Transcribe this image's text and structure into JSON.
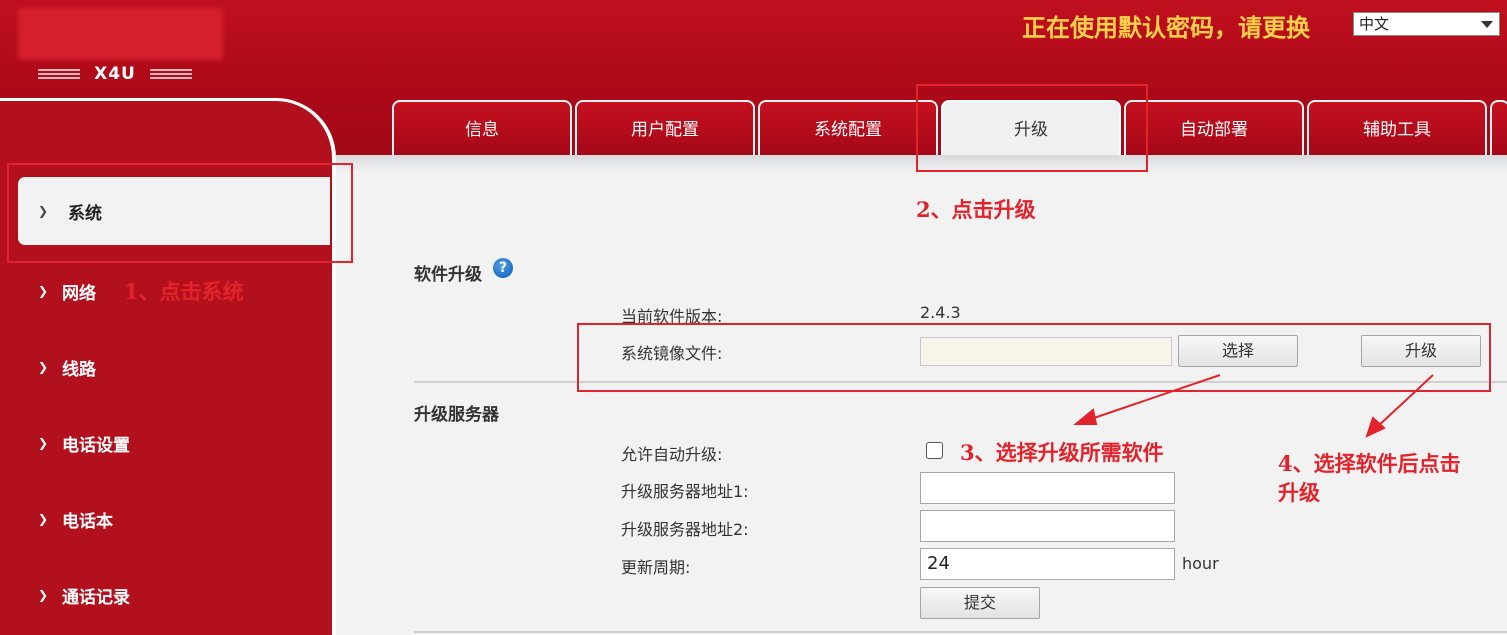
{
  "header": {
    "model": "X4U",
    "warning": "正在使用默认密码，请更换",
    "language": "中文"
  },
  "tabs": [
    {
      "label": "信息"
    },
    {
      "label": "用户配置"
    },
    {
      "label": "系统配置"
    },
    {
      "label": "升级"
    },
    {
      "label": "自动部署"
    },
    {
      "label": "辅助工具"
    }
  ],
  "sidebar": {
    "items": [
      {
        "label": "系统"
      },
      {
        "label": "网络"
      },
      {
        "label": "线路"
      },
      {
        "label": "电话设置"
      },
      {
        "label": "电话本"
      },
      {
        "label": "通话记录"
      }
    ]
  },
  "software_upgrade": {
    "title": "软件升级",
    "help_glyph": "?",
    "current_version_label": "当前软件版本:",
    "current_version_value": "2.4.3",
    "image_file_label": "系统镜像文件:",
    "select_button": "选择",
    "upgrade_button": "升级"
  },
  "upgrade_server": {
    "title": "升级服务器",
    "auto_upgrade_label": "允许自动升级:",
    "server1_label": "升级服务器地址1:",
    "server1_value": "",
    "server2_label": "升级服务器地址2:",
    "server2_value": "",
    "period_label": "更新周期:",
    "period_value": "24",
    "period_unit": "hour",
    "submit_button": "提交"
  },
  "annotations": {
    "step1": "1、点击系统",
    "step2": "2、点击升级",
    "step3": "3、选择升级所需软件",
    "step4_line1": "4、选择软件后点击",
    "step4_line2": "升级",
    "color": "#e3232c"
  }
}
